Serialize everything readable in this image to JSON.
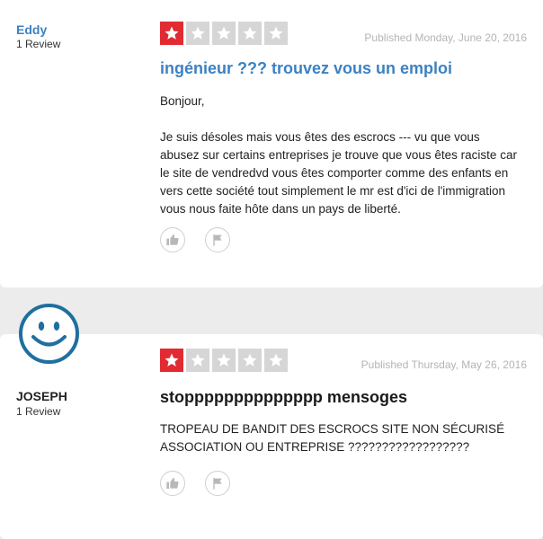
{
  "reviews": [
    {
      "user": {
        "name": "Eddy",
        "review_count": "1 Review"
      },
      "rating": 1,
      "published": "Published Monday, June 20, 2016",
      "title": "ingénieur ??? trouvez vous un emploi",
      "paragraphs": [
        "Bonjour,",
        "Je suis désoles mais vous êtes des escrocs --- vu que vous abusez sur certains entreprises je trouve que vous êtes raciste car le site de vendredvd vous êtes comporter comme des enfants en vers cette société tout simplement le mr est d'ici de l'immigration vous nous faite hôte dans un pays de liberté."
      ]
    },
    {
      "user": {
        "name": "JOSEPH",
        "review_count": "1 Review",
        "avatar_icon": "smiley-face-icon"
      },
      "rating": 1,
      "published": "Published Thursday, May 26, 2016",
      "title": "stopppppppppppppp mensoges",
      "paragraphs": [
        "TROPEAU DE BANDIT DES ESCROCS SITE NON SÉCURISÉ ASSOCIATION OU ENTREPRISE ??????????????????"
      ]
    }
  ],
  "icons": {
    "star": "star-icon",
    "like": "thumbs-up-icon",
    "report": "flag-icon"
  },
  "colors": {
    "accent_blue": "#3b82c4",
    "star_red": "#e12a31",
    "star_gray": "#d6d6d6",
    "avatar_blue": "#1f6f9f"
  }
}
